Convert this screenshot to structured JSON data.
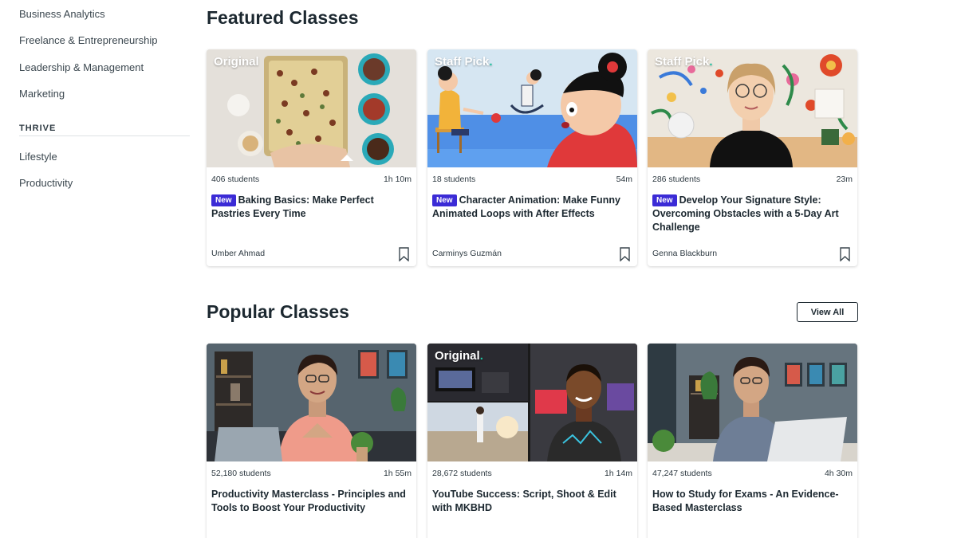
{
  "sidebar": {
    "links_top": [
      "Business Analytics",
      "Freelance & Entrepreneurship",
      "Leadership & Management",
      "Marketing"
    ],
    "section_heading": "THRIVE",
    "links_bottom": [
      "Lifestyle",
      "Productivity"
    ]
  },
  "featured": {
    "title": "Featured Classes",
    "cards": [
      {
        "badge": "Original",
        "students": "406 students",
        "duration": "1h 10m",
        "new_tag": "New",
        "title": "Baking Basics: Make Perfect Pastries Every Time",
        "teacher": "Umber Ahmad"
      },
      {
        "badge": "Staff Pick",
        "students": "18 students",
        "duration": "54m",
        "new_tag": "New",
        "title": "Character Animation: Make Funny Animated Loops with After Effects",
        "teacher": "Carminys Guzmán"
      },
      {
        "badge": "Staff Pick",
        "students": "286 students",
        "duration": "23m",
        "new_tag": "New",
        "title": "Develop Your Signature Style: Overcoming Obstacles with a 5-Day Art Challenge",
        "teacher": "Genna Blackburn"
      }
    ]
  },
  "popular": {
    "title": "Popular Classes",
    "view_all": "View All",
    "cards": [
      {
        "badge": "",
        "students": "52,180 students",
        "duration": "1h 55m",
        "title": "Productivity Masterclass - Principles and Tools to Boost Your Productivity"
      },
      {
        "badge": "Original",
        "students": "28,672 students",
        "duration": "1h 14m",
        "title": "YouTube Success: Script, Shoot & Edit with MKBHD"
      },
      {
        "badge": "",
        "students": "47,247 students",
        "duration": "4h 30m",
        "title": "How to Study for Exams - An Evidence-Based Masterclass"
      }
    ]
  },
  "icons": {
    "bookmark": "bookmark-icon"
  },
  "colors": {
    "new_tag": "#3b2bd6",
    "badge_dot": "#20c4a3",
    "text": "#1c2830"
  }
}
